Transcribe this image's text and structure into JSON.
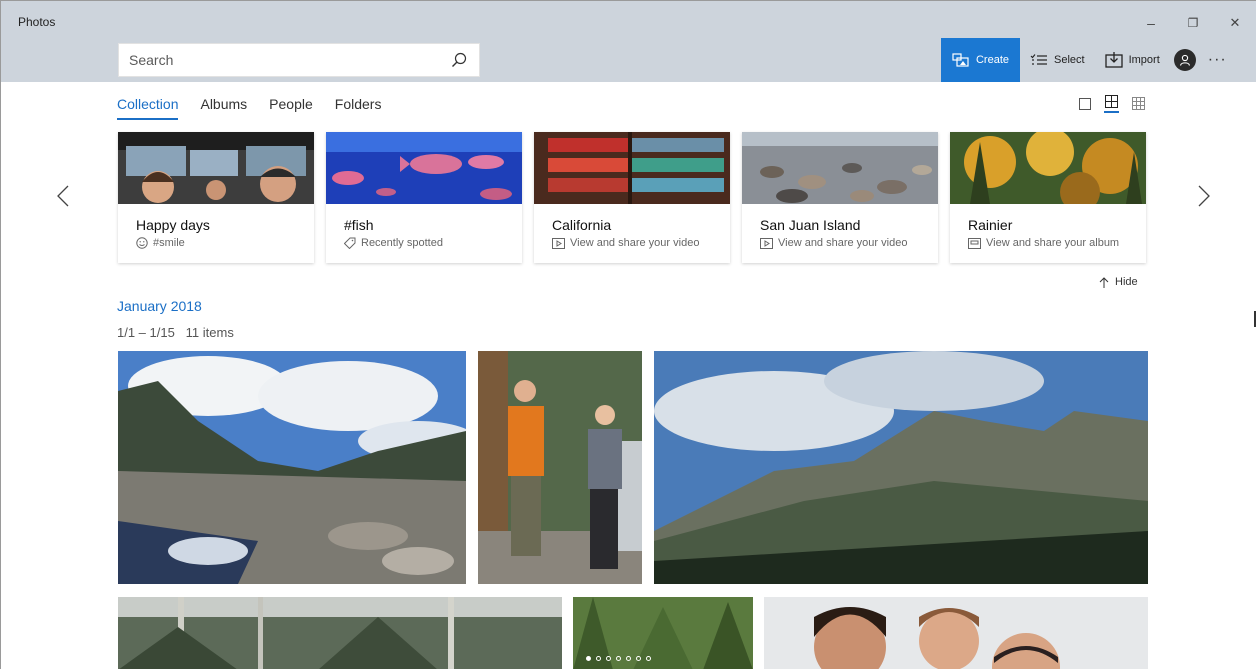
{
  "app": {
    "title": "Photos"
  },
  "window_controls": {
    "minimize": "–",
    "restore": "❐",
    "close": "✕"
  },
  "search": {
    "placeholder": "Search",
    "value": ""
  },
  "toolbar": {
    "create_label": "Create",
    "select_label": "Select",
    "import_label": "Import",
    "more_label": "···"
  },
  "tabs": [
    {
      "label": "Collection",
      "active": true
    },
    {
      "label": "Albums",
      "active": false
    },
    {
      "label": "People",
      "active": false
    },
    {
      "label": "Folders",
      "active": false
    }
  ],
  "cards": [
    {
      "title": "Happy days",
      "subtitle": "#smile",
      "icon": "smile-icon"
    },
    {
      "title": "#fish",
      "subtitle": "Recently spotted",
      "icon": "tag-icon"
    },
    {
      "title": "California",
      "subtitle": "View and share your video",
      "icon": "video-icon"
    },
    {
      "title": "San Juan Island",
      "subtitle": "View and share your video",
      "icon": "video-icon"
    },
    {
      "title": "Rainier",
      "subtitle": "View and share your album",
      "icon": "album-icon"
    }
  ],
  "hide_label": "Hide",
  "section": {
    "month": "January 2018",
    "range": "1/1 – 1/15",
    "count": "11 items"
  },
  "colors": {
    "accent": "#1b78d2",
    "link": "#1b6fc6",
    "titlebar": "#cdd4dc"
  }
}
